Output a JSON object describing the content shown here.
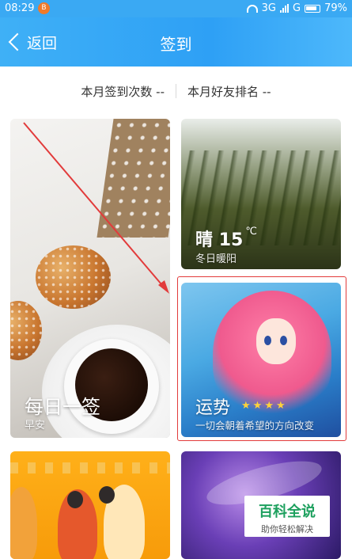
{
  "status_bar": {
    "time": "08:29",
    "notification_badge": "B",
    "network": "3G",
    "network2": "G",
    "battery": "79%"
  },
  "nav": {
    "back_label": "返回",
    "title": "签到"
  },
  "stats": {
    "monthly_checkins": "本月签到次数 --",
    "friend_rank": "本月好友排名 --"
  },
  "cards": {
    "daily": {
      "title": "每日一签",
      "subtitle": "早安"
    },
    "weather": {
      "condition": "晴",
      "temperature": "15",
      "unit": "℃",
      "subtitle": "冬日暖阳"
    },
    "fortune": {
      "title": "运势",
      "stars": 4,
      "subtitle": "一切会朝着希望的方向改变"
    }
  },
  "watermark": {
    "title": "百科全说",
    "subtitle": "助你轻松解决"
  },
  "colors": {
    "nav_blue": "#2ea0f5",
    "highlight_red": "#e23b3b",
    "star_yellow": "#ffd33a",
    "watermark_green": "#1da05e"
  }
}
